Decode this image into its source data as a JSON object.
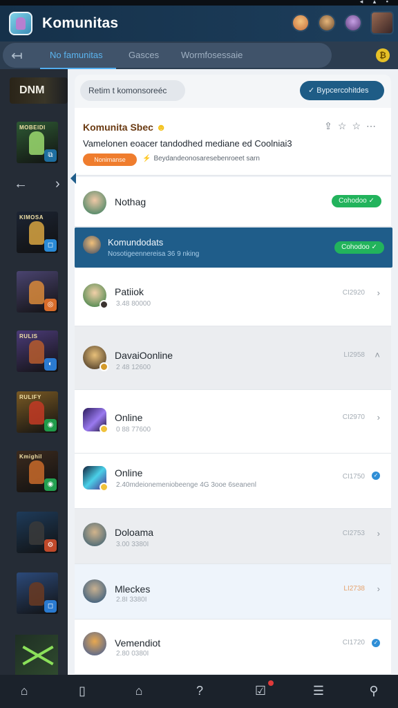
{
  "app": {
    "title": "Komunitas"
  },
  "tabs": {
    "items": [
      {
        "label": "No famunitas",
        "active": true
      },
      {
        "label": "Gasces",
        "active": false
      },
      {
        "label": "Wormfosessaie",
        "active": false
      }
    ]
  },
  "sidebar": {
    "logo_text": "DNM",
    "thumbs": [
      {
        "title": "MOBEIDI",
        "bg": "#2e5a34",
        "fig": "#9bdb6e",
        "badge": "#1e6ea0"
      },
      {
        "title": "KIMOSA",
        "bg": "#1c2433",
        "fig": "#d8a441",
        "badge": "#2a8ad6"
      },
      {
        "title": "",
        "bg": "#4a4470",
        "fig": "#d98a3a",
        "badge": "#d86c2a"
      },
      {
        "title": "RULIS",
        "bg": "#4b3b78",
        "fig": "#b65c2e",
        "badge": "#2a7ad0"
      },
      {
        "title": "RULIFY",
        "bg": "#7a5a24",
        "fig": "#c23a24",
        "badge": "#1f9b4a"
      },
      {
        "title": "Kmighil",
        "bg": "#3b2a1e",
        "fig": "#c86a2a",
        "badge": "#23a050"
      },
      {
        "title": "",
        "bg": "#1e3b5a",
        "fig": "#3a3a3a",
        "badge": "#c0492a"
      },
      {
        "title": "",
        "bg": "#2c4a7a",
        "fig": "#6a3a22",
        "badge": "#2a7ad0"
      }
    ]
  },
  "header": {
    "search_chip": "Retim t komonsoreéc",
    "cta_label": "✓ Bypcercohitdes"
  },
  "featured": {
    "title": "Komunita Sbec",
    "subtitle": "Vamelonen eoacer tandodhed mediane ed Coolniai3",
    "tag": "Nonimanse",
    "note": "Beydandeonosaresebenroeet sarn"
  },
  "rows": [
    {
      "name": "Nothag",
      "meta": "",
      "code": "",
      "pill": "Cohodoo ✓"
    },
    {
      "name": "Patiiok",
      "meta": "3.48 80000",
      "code": "CI2920"
    },
    {
      "name": "DavaiOonline",
      "meta": "2 48 12600",
      "code": "LI2958"
    },
    {
      "name": "Online",
      "meta": "0 88 77600",
      "code": "CI2970"
    },
    {
      "name": "Online",
      "meta": "2.40mdeionemeniobeenge 4G 3ooe 6seanenl",
      "code": "CI1750"
    },
    {
      "name": "Doloama",
      "meta": "3.00 3380I",
      "code": "CI2753"
    },
    {
      "name": "Mleckes",
      "meta": "2.8I 3380I",
      "code": "LI2738"
    },
    {
      "name": "Vemendiot",
      "meta": "2.80 0380I",
      "code": "CI1720"
    }
  ],
  "selected": {
    "name": "Komundodats",
    "meta": "Nosotigeennereisa 36 9 nking",
    "pill": "Cohodoo ✓"
  }
}
